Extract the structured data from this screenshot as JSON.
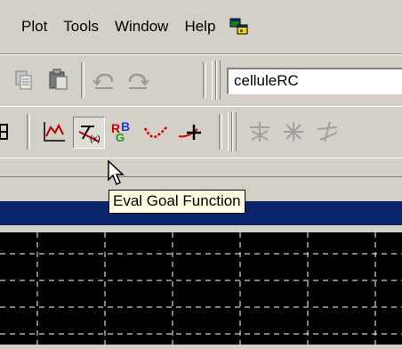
{
  "menu": {
    "items": [
      {
        "label": "Plot"
      },
      {
        "label": "Tools"
      },
      {
        "label": "Window"
      },
      {
        "label": "Help"
      }
    ],
    "app_icon": "dialog-windows-icon"
  },
  "toolbar1": {
    "icons": [
      "copy-icon",
      "paste-icon",
      "undo-icon",
      "redo-icon"
    ],
    "combo_value": "celluleRC"
  },
  "toolbar2": {
    "icons": [
      "axes-icon",
      "eval-goal-function-icon",
      "rgb-color-icon",
      "red-curve-icon",
      "marker-icon",
      "star-icon",
      "star-icon",
      "star-icon"
    ]
  },
  "tooltip": {
    "text": "Eval Goal Function"
  },
  "colors": {
    "titlebar": "#0a246a",
    "face": "#d4d0c8",
    "tooltip_bg": "#ffffe1",
    "plot_bg": "#000000"
  }
}
